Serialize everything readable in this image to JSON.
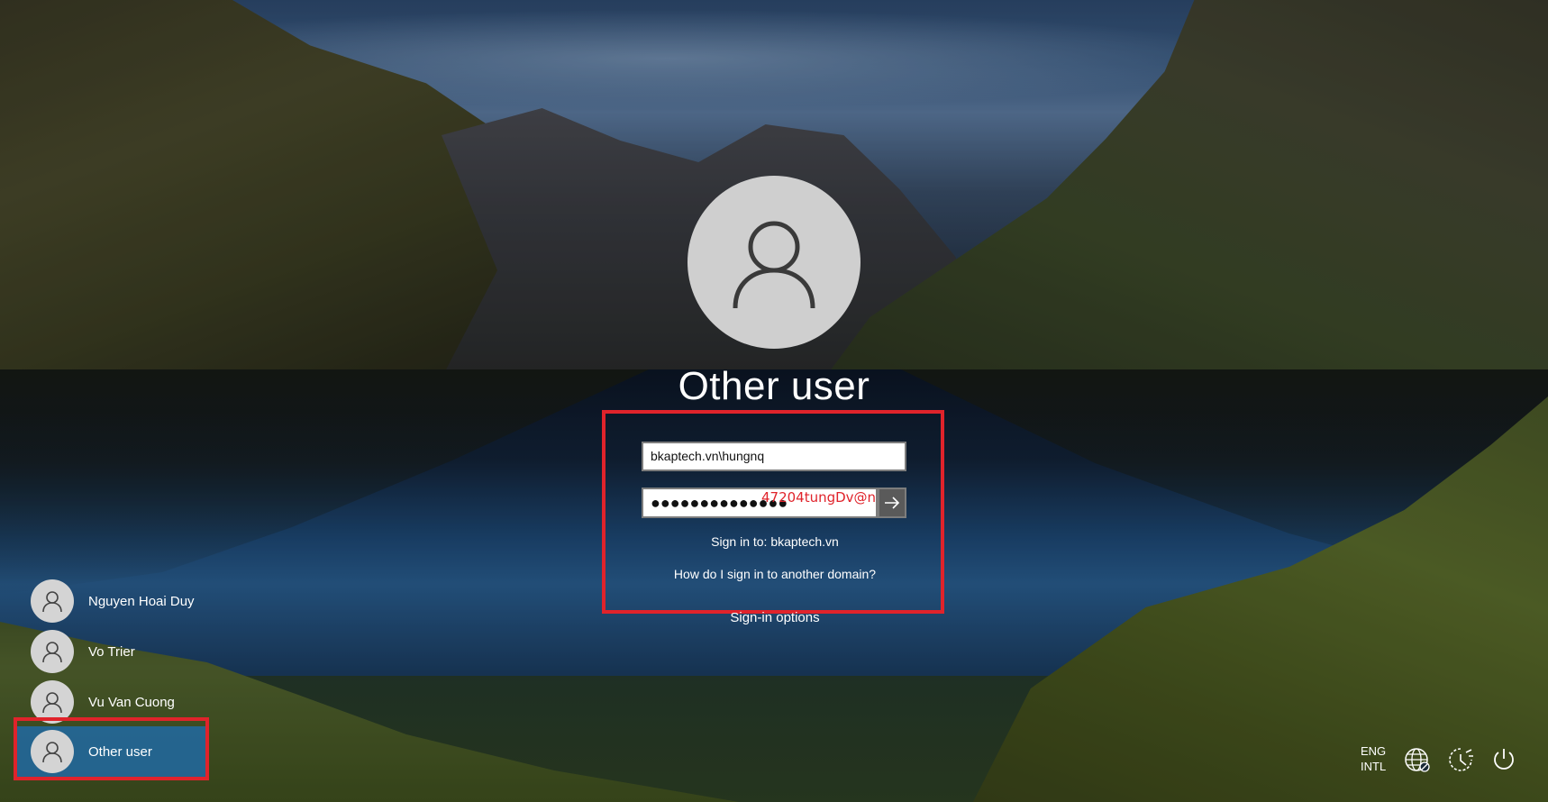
{
  "login": {
    "title": "Other user",
    "username_value": "bkaptech.vn\\hungnq",
    "password_dots": "●●●●●●●●●●●●●●",
    "password_reveal_annotation": "47204tungDv@n",
    "sign_in_to": "Sign in to: bkaptech.vn",
    "other_domain_link": "How do I sign in to another domain?",
    "sign_in_options": "Sign-in options",
    "submit_icon": "arrow-right-icon"
  },
  "users": [
    {
      "name": "Nguyen Hoai Duy",
      "selected": false
    },
    {
      "name": "Vo Trier",
      "selected": false
    },
    {
      "name": "Vu Van Cuong",
      "selected": false
    },
    {
      "name": "Other user",
      "selected": true
    }
  ],
  "tray": {
    "lang_line1": "ENG",
    "lang_line2": "INTL",
    "icons": [
      "network-icon",
      "accessibility-icon",
      "power-icon"
    ]
  },
  "colors": {
    "highlight": "#e0232b",
    "selected_user_bg": "#1e6eb4",
    "annotation_text": "#e0232b"
  }
}
